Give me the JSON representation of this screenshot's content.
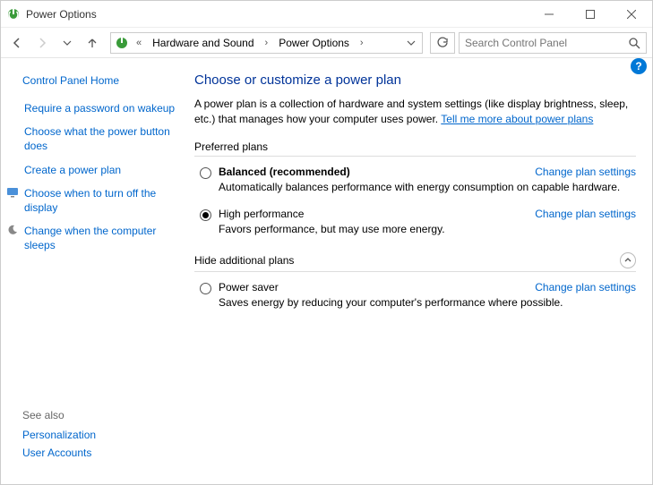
{
  "window": {
    "title": "Power Options"
  },
  "breadcrumb": {
    "prefix": "«",
    "items": [
      "Hardware and Sound",
      "Power Options"
    ]
  },
  "search": {
    "placeholder": "Search Control Panel"
  },
  "sidebar": {
    "home": "Control Panel Home",
    "items": [
      {
        "label": "Require a password on wakeup",
        "icon": null
      },
      {
        "label": "Choose what the power button does",
        "icon": null
      },
      {
        "label": "Create a power plan",
        "icon": null
      },
      {
        "label": "Choose when to turn off the display",
        "icon": "monitor"
      },
      {
        "label": "Change when the computer sleeps",
        "icon": "moon"
      }
    ],
    "see_also_label": "See also",
    "see_also": [
      "Personalization",
      "User Accounts"
    ]
  },
  "main": {
    "title": "Choose or customize a power plan",
    "intro_text": "A power plan is a collection of hardware and system settings (like display brightness, sleep, etc.) that manages how your computer uses power. ",
    "intro_link": "Tell me more about power plans",
    "preferred_label": "Preferred plans",
    "additional_label": "Hide additional plans",
    "change_link": "Change plan settings",
    "plans": [
      {
        "name": "Balanced (recommended)",
        "desc": "Automatically balances performance with energy consumption on capable hardware.",
        "selected": false,
        "bold": true
      },
      {
        "name": "High performance",
        "desc": "Favors performance, but may use more energy.",
        "selected": true,
        "bold": false
      }
    ],
    "additional_plans": [
      {
        "name": "Power saver",
        "desc": "Saves energy by reducing your computer's performance where possible.",
        "selected": false,
        "bold": false
      }
    ]
  }
}
